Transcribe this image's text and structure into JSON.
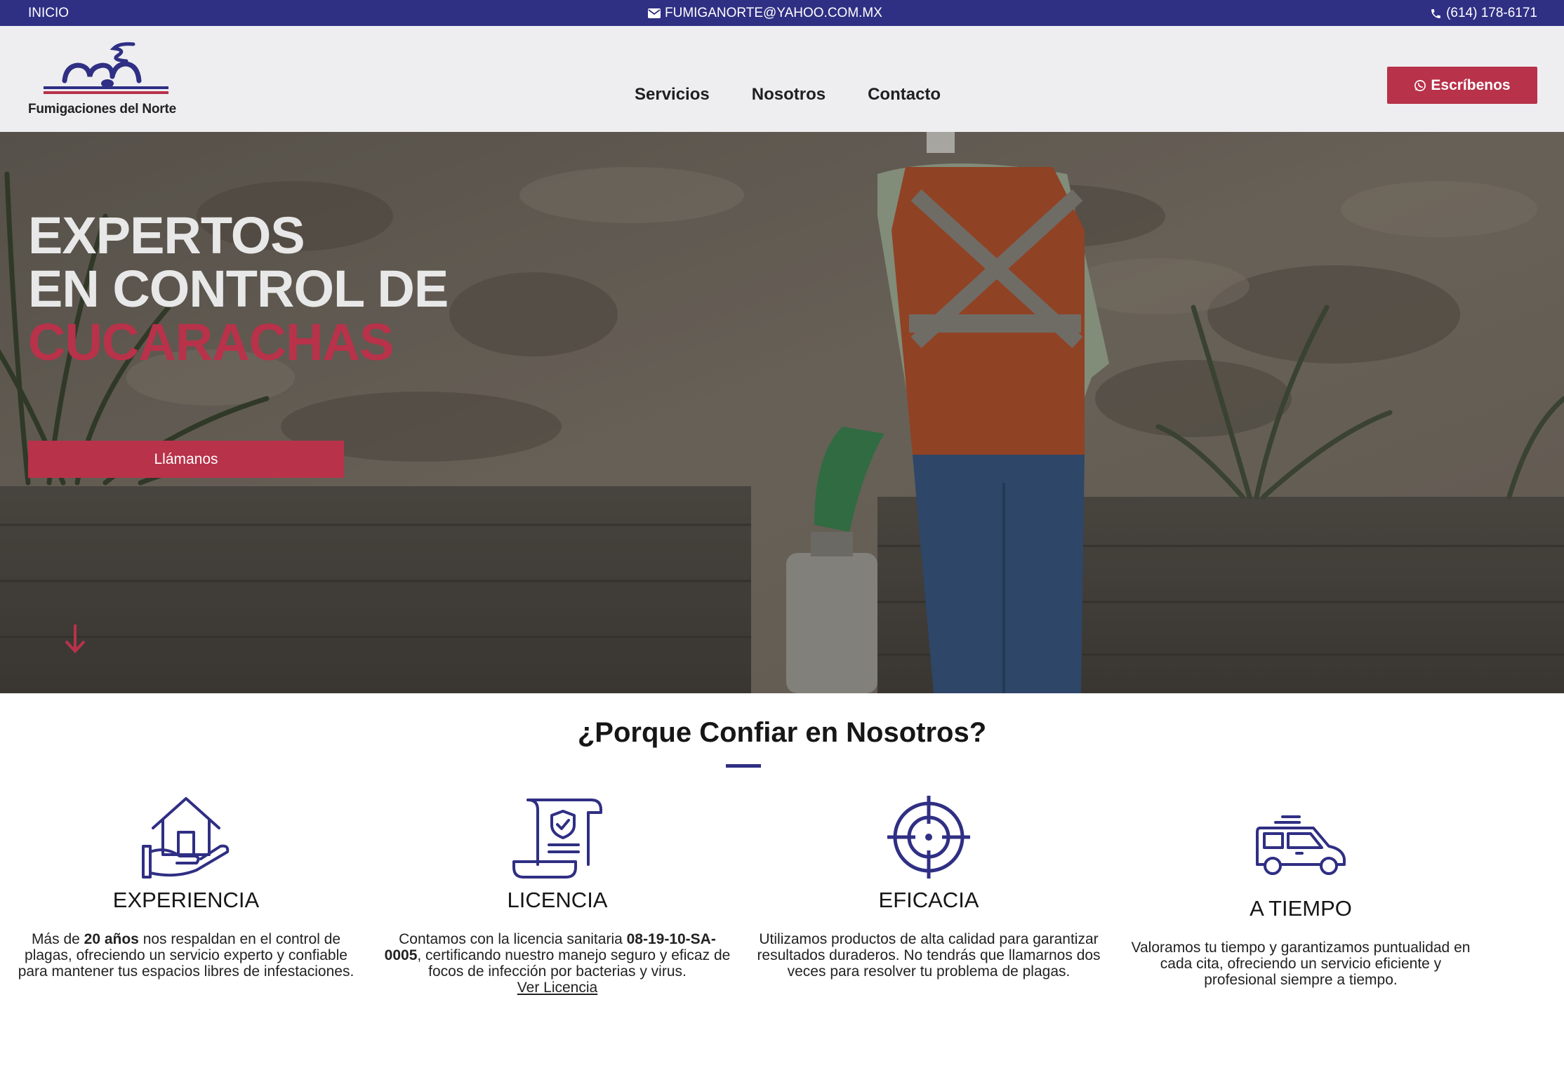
{
  "topbar": {
    "home": "INICIO",
    "email": "FUMIGANORTE@YAHOO.COM.MX",
    "phone": "(614) 178-6171"
  },
  "header": {
    "logo_text": "Fumigaciones del Norte",
    "nav": [
      "Servicios",
      "Nosotros",
      "Contacto"
    ],
    "cta": "Escríbenos"
  },
  "hero": {
    "line1": "EXPERTOS",
    "line2": "EN CONTROL DE",
    "line3": "CUCARACHAS",
    "button": "Llámanos"
  },
  "why": {
    "title": "¿Porque Confiar en Nosotros?",
    "features": [
      {
        "icon": "house-hand-icon",
        "title": "EXPERIENCIA",
        "pre": "Más de ",
        "bold": "20 años",
        "post": " nos respaldan en el control de plagas, ofreciendo un servicio experto y confiable para mantener tus espacios libres de infestaciones."
      },
      {
        "icon": "license-certificate-icon",
        "title": "LICENCIA",
        "pre": "Contamos con la licencia sanitaria ",
        "bold": "08-19-10-SA-0005",
        "post": ", certificando nuestro manejo seguro y eficaz de focos de infección por bacterias y virus.",
        "link": "Ver Licencia"
      },
      {
        "icon": "target-icon",
        "title": "EFICACIA",
        "text": "Utilizamos productos de alta calidad para garantizar resultados duraderos. No tendrás que llamarnos dos veces para resolver tu problema de plagas."
      },
      {
        "icon": "van-icon",
        "title": "A TIEMPO",
        "text": "Valoramos tu tiempo y garantizamos puntualidad en cada cita, ofreciendo un servicio eficiente y profesional siempre a tiempo."
      }
    ]
  },
  "colors": {
    "brand_blue": "#2f2f84",
    "brand_red": "#b8324a",
    "header_bg": "#eeeef1"
  }
}
